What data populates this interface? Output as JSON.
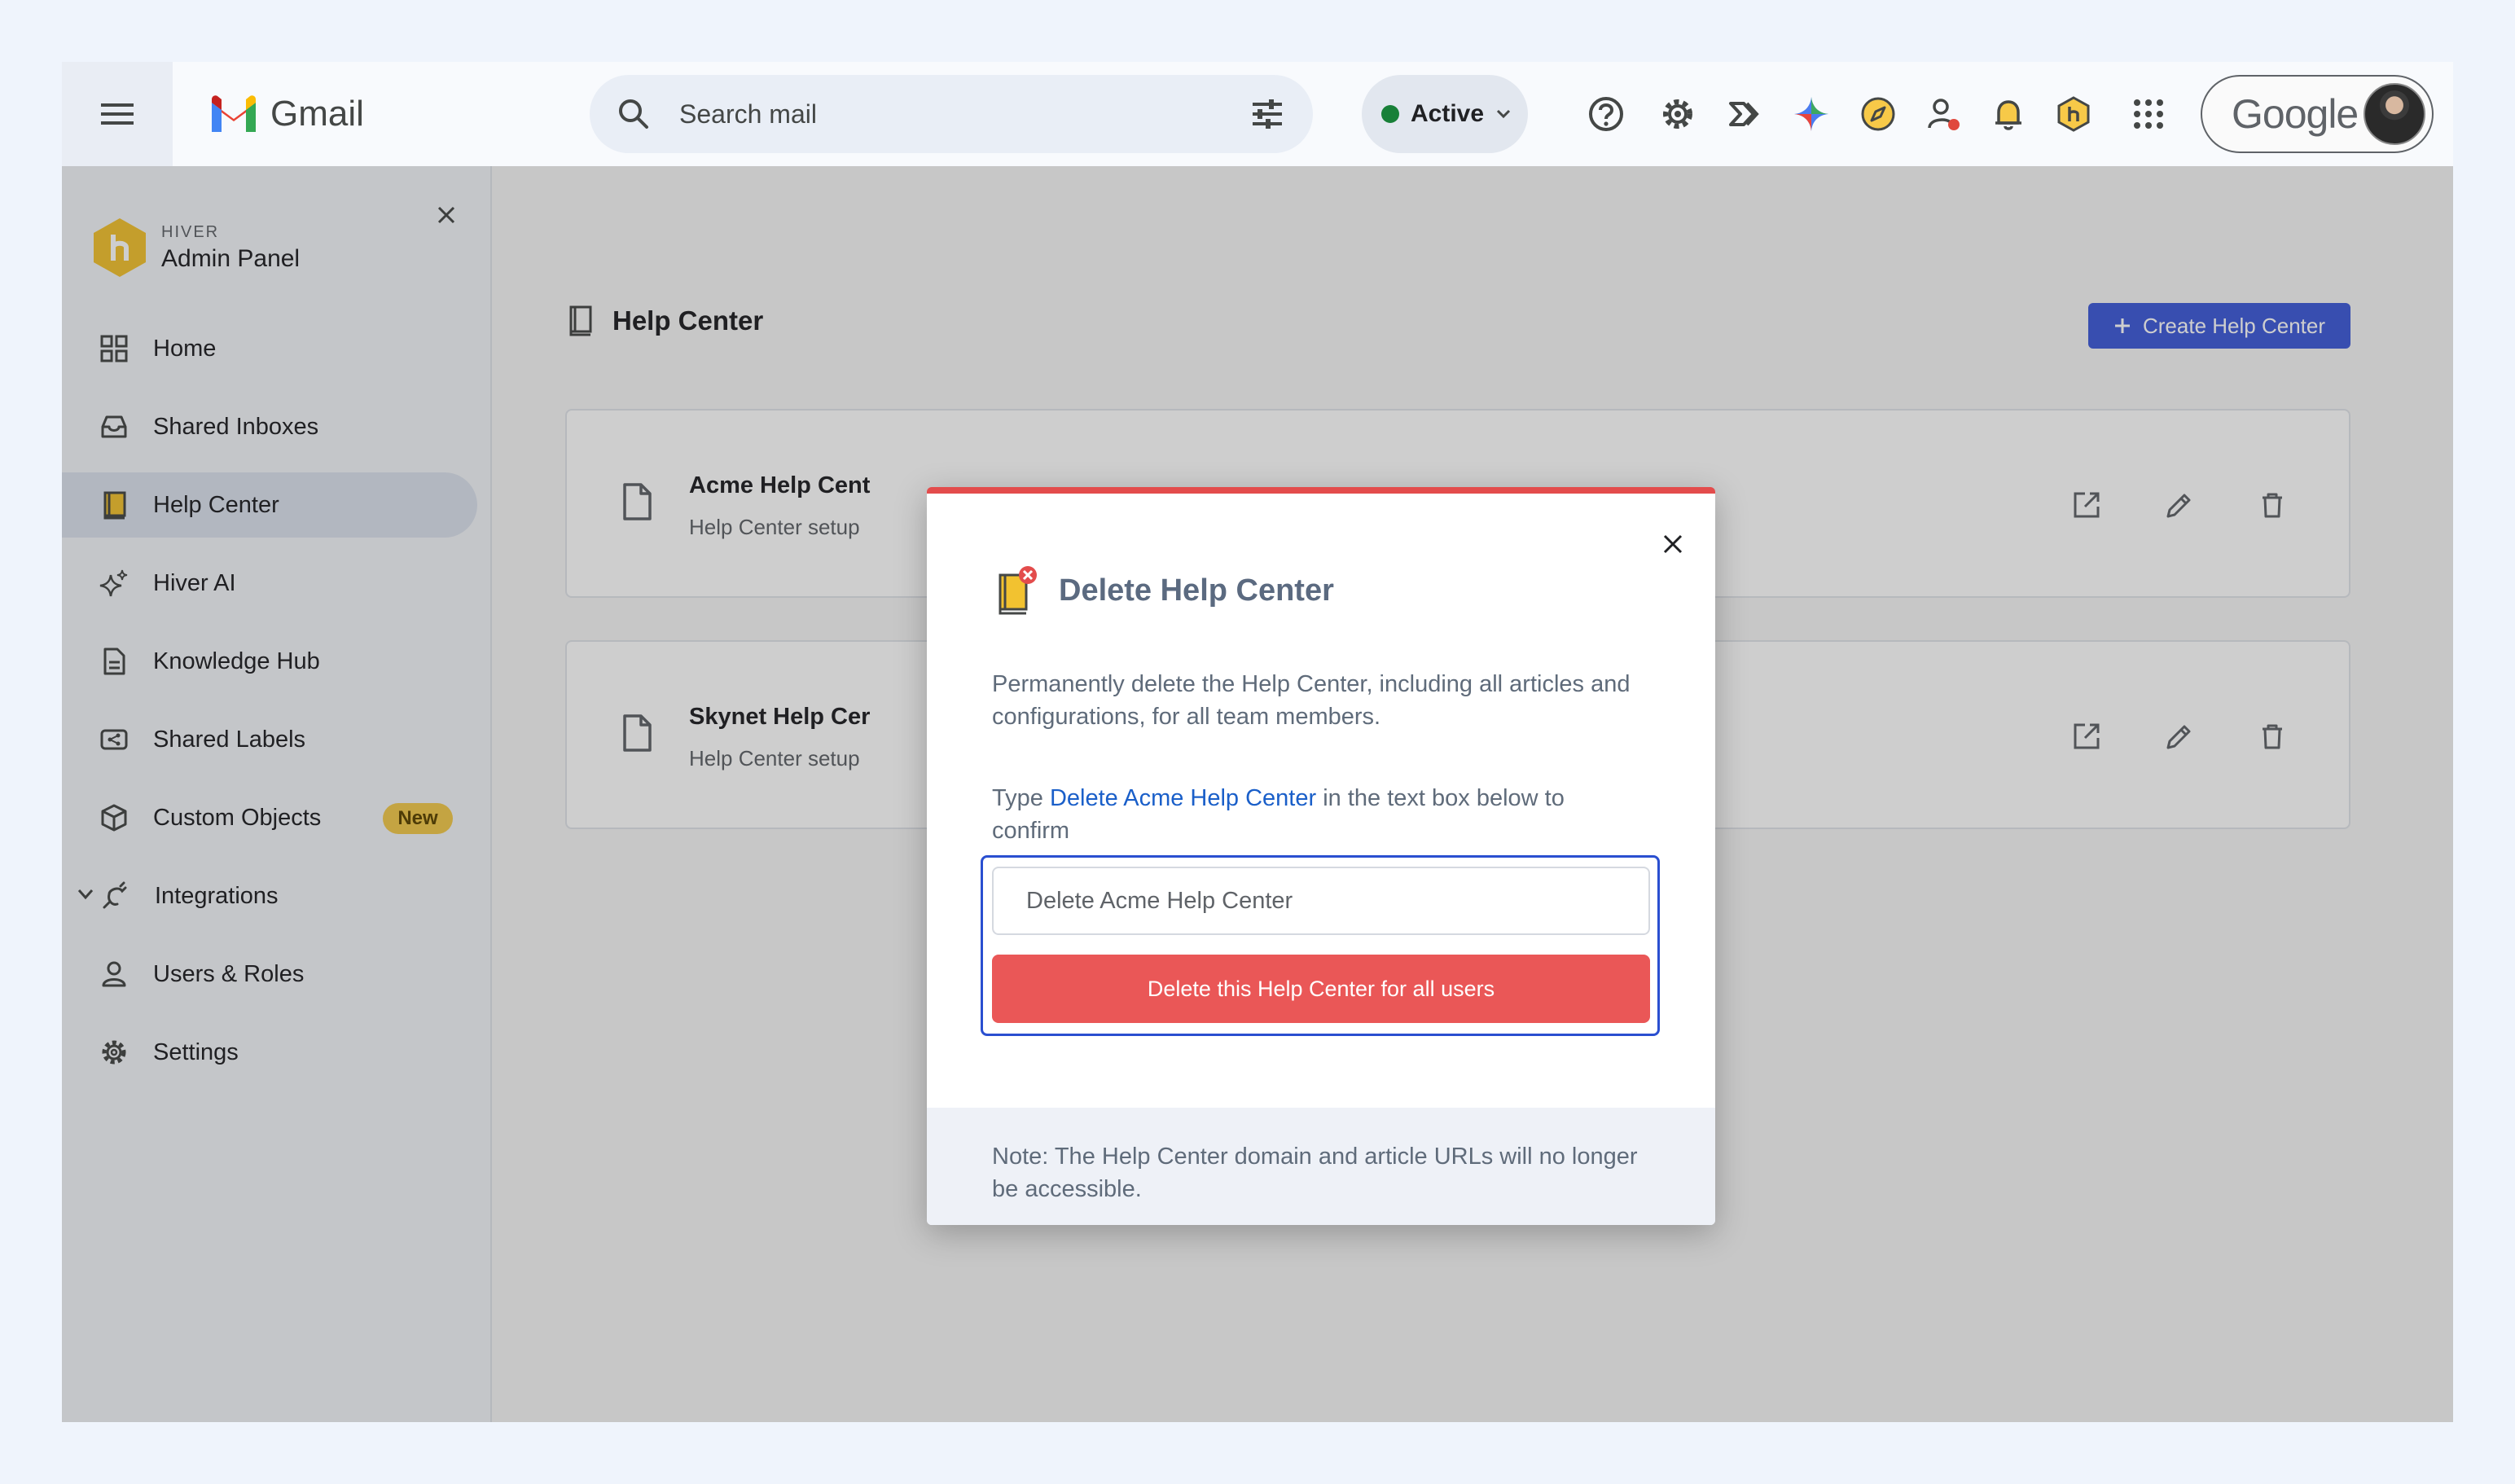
{
  "topbar": {
    "app_name": "Gmail",
    "search_placeholder": "Search mail",
    "status_label": "Active",
    "account_brand": "Google"
  },
  "sidebar": {
    "brand_small": "HIVER",
    "brand_big": "Admin Panel",
    "items": [
      {
        "label": "Home"
      },
      {
        "label": "Shared Inboxes"
      },
      {
        "label": "Help Center"
      },
      {
        "label": "Hiver AI"
      },
      {
        "label": "Knowledge Hub"
      },
      {
        "label": "Shared Labels"
      },
      {
        "label": "Custom Objects",
        "badge": "New"
      },
      {
        "label": "Integrations"
      },
      {
        "label": "Users & Roles"
      },
      {
        "label": "Settings"
      }
    ]
  },
  "content": {
    "page_title": "Help Center",
    "create_button": "Create Help Center",
    "cards": [
      {
        "name": "Acme Help Cent",
        "sub": "Help Center setup"
      },
      {
        "name": "Skynet Help Cer",
        "sub": "Help Center setup"
      }
    ]
  },
  "modal": {
    "title": "Delete Help Center",
    "description": "Permanently delete the Help Center, including all articles and configurations, for all team members.",
    "confirm_prefix": "Type ",
    "confirm_highlight": "Delete Acme Help Center",
    "confirm_suffix": " in the text box below to confirm",
    "input_placeholder": "Delete Acme Help Center",
    "delete_button": "Delete this Help Center for all users",
    "note": "Note: The Help Center domain and article URLs will no longer be accessible."
  },
  "colors": {
    "accent": "#3f5bd9",
    "danger": "#ea5757",
    "link": "#1a5fc9",
    "status_green": "#188038",
    "badge_yellow": "#f2c94c"
  }
}
